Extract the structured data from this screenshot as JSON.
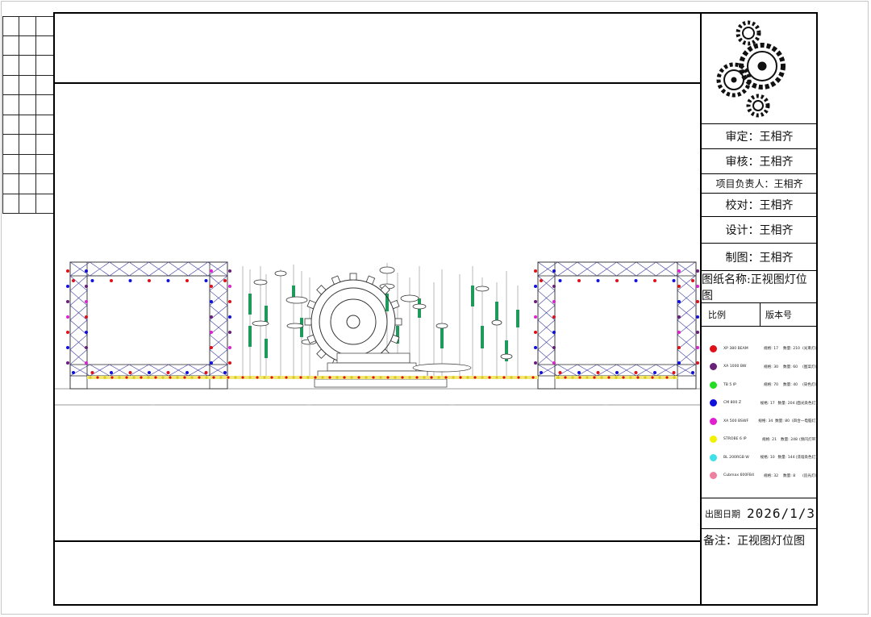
{
  "title_block": {
    "approved": "审定：王相齐",
    "checked": "审核：王相齐",
    "project_lead": "项目负责人：王相齐",
    "proofread": "校对：王相齐",
    "design": "设计：王相齐",
    "drawn": "制图：王相齐",
    "drawing_name": "图纸名称:正视图灯位图",
    "scale_label": "比例",
    "version_label": "版本号",
    "date_label": "出图日期",
    "date_value": "2026/1/3",
    "remark": "备注：正视图灯位图"
  },
  "legend": [
    {
      "name": "XP 380 BEAM",
      "c1": "规格: 17",
      "c2": "数量: 210",
      "note": "(光束灯)",
      "color": "#e0101a"
    },
    {
      "name": "XA 1000 BW",
      "c1": "规格: 30",
      "c2": "数量: 60",
      "note": "(图案灯)",
      "color": "#6a1f78"
    },
    {
      "name": "TB 5 IP",
      "c1": "规格: 70",
      "c2": "数量: 40",
      "note": "(染色灯)",
      "color": "#22dd22"
    },
    {
      "name": "CM 800 Z",
      "c1": "规格: 17",
      "c2": "数量: 204",
      "note": "(面光染色灯)",
      "color": "#1010dd"
    },
    {
      "name": "XA 500 BSWF",
      "c1": "规格: 34",
      "c2": "数量: 80",
      "note": "(四合一电脑灯)",
      "color": "#e020d0"
    },
    {
      "name": "STROBE 6 IP",
      "c1": "规格: 21",
      "c2": "数量: 248",
      "note": "(频闪灯带)",
      "color": "#f2f200"
    },
    {
      "name": "BL 200RGB W",
      "c1": "规格: 10",
      "c2": "数量: 144",
      "note": "(洗墙染色灯)",
      "color": "#40e0e8"
    },
    {
      "name": "Cubmax 600FB4",
      "c1": "规格: 32",
      "c2": "数量: 8",
      "note": "(追光灯)",
      "color": "#f080a0"
    }
  ],
  "icons": {
    "logo": "gears-logo-icon"
  }
}
